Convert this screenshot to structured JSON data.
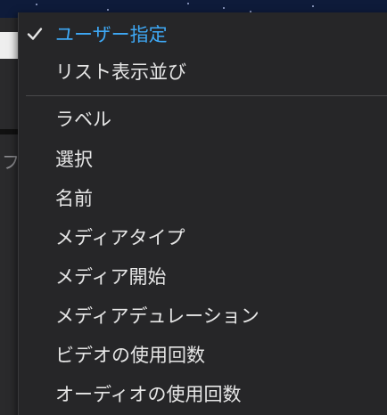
{
  "menu": {
    "items": [
      {
        "label": "ユーザー指定",
        "selected": true
      },
      {
        "label": "リスト表示並び",
        "selected": false
      },
      {
        "label": "ラベル",
        "selected": false
      },
      {
        "label": "選択",
        "selected": false
      },
      {
        "label": "名前",
        "selected": false
      },
      {
        "label": "メディアタイプ",
        "selected": false
      },
      {
        "label": "メディア開始",
        "selected": false
      },
      {
        "label": "メディアデュレーション",
        "selected": false
      },
      {
        "label": "ビデオの使用回数",
        "selected": false
      },
      {
        "label": "オーディオの使用回数",
        "selected": false
      }
    ]
  },
  "background": {
    "partial_label": "フ"
  },
  "colors": {
    "selected_text": "#3ea8f5",
    "menu_text": "#e6e6e6",
    "menu_bg": "#262628"
  },
  "icons": {
    "selected_marker": "checkmark-icon"
  }
}
